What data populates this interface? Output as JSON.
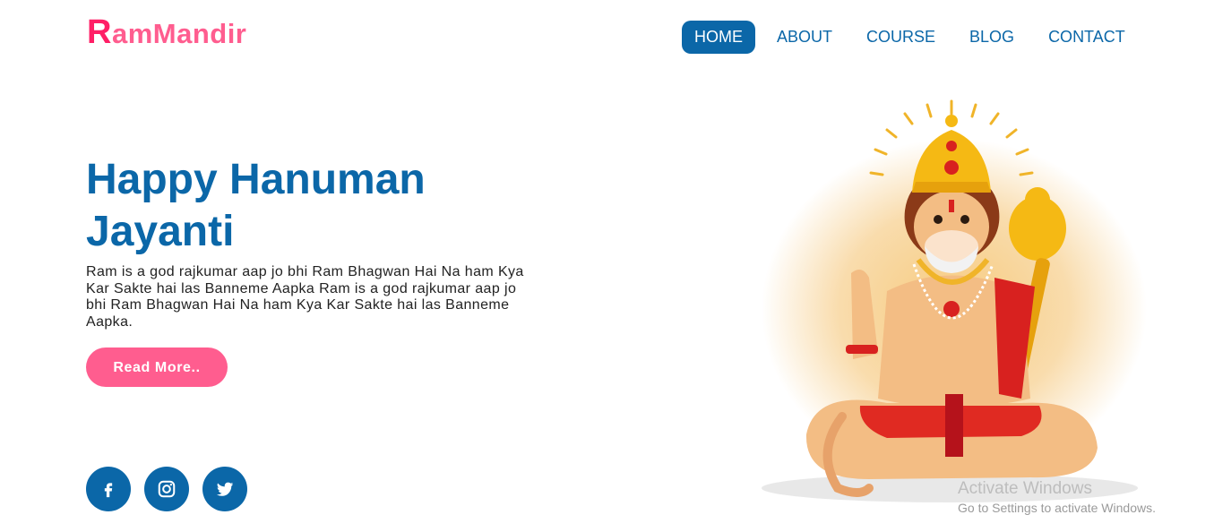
{
  "brand": {
    "first_letter": "R",
    "rest": "amMandir"
  },
  "nav": {
    "items": [
      {
        "label": "HOME",
        "active": true
      },
      {
        "label": "ABOUT",
        "active": false
      },
      {
        "label": "COURSE",
        "active": false
      },
      {
        "label": "BLOG",
        "active": false
      },
      {
        "label": "CONTACT",
        "active": false
      }
    ]
  },
  "hero": {
    "title_line1": "Happy Hanuman",
    "title_line2": "Jayanti",
    "description": "Ram is a god rajkumar aap jo bhi Ram Bhagwan Hai Na ham Kya Kar Sakte hai las Banneme Aapka Ram is a god rajkumar aap jo bhi Ram Bhagwan Hai Na ham Kya Kar Sakte hai las Banneme Aapka.",
    "button_label": "Read More.."
  },
  "social": [
    {
      "icon": "facebook-icon"
    },
    {
      "icon": "instagram-icon"
    },
    {
      "icon": "twitter-icon"
    }
  ],
  "watermark": {
    "line1": "Activate Windows",
    "line2": "Go to Settings to activate Windows."
  },
  "colors": {
    "primary": "#0b67a8",
    "accent": "#ff5d8f",
    "logo_first": "#ff1f66"
  }
}
